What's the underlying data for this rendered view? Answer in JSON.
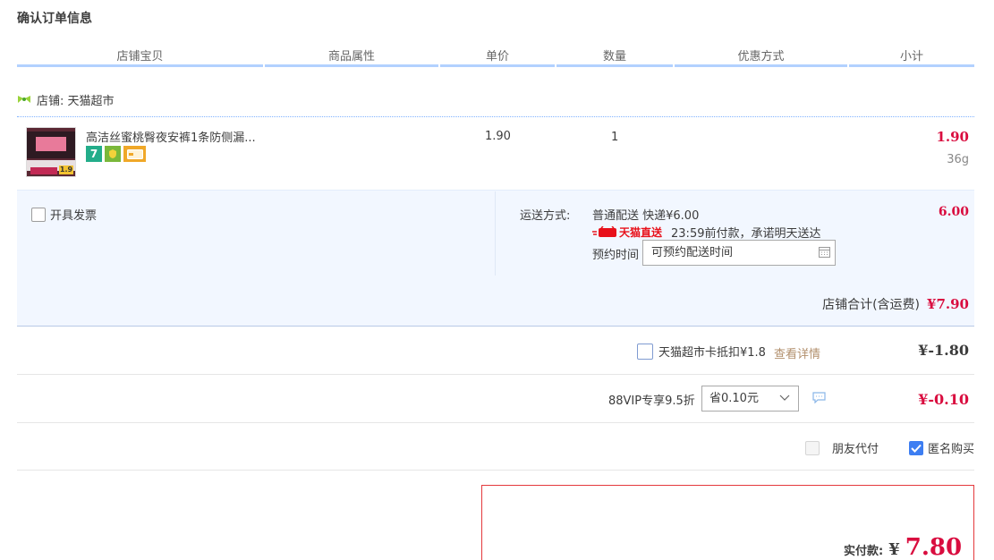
{
  "page_title": "确认订单信息",
  "columns": [
    "店铺宝贝",
    "商品属性",
    "单价",
    "数量",
    "优惠方式",
    "小计"
  ],
  "shop": {
    "label": "店铺: 天猫超市"
  },
  "item": {
    "title": "高洁丝蜜桃臀夜安裤1条防侧漏...",
    "thumb_price": "1.9",
    "unit_price": "1.90",
    "quantity": "1",
    "subtotal": "1.90",
    "weight": "36g",
    "badges": [
      {
        "icon": "seven-day-return-icon",
        "text": "7",
        "color": "#23ad8a"
      },
      {
        "icon": "guarantee-icon",
        "text": "",
        "color": "#7ab83a"
      },
      {
        "icon": "card-payment-icon",
        "text": "",
        "color": "#f0a828"
      }
    ]
  },
  "invoice": {
    "label": "开具发票"
  },
  "shipping": {
    "label": "运送方式:",
    "method": "普通配送 快递¥6.00",
    "tmall_tag": "天猫直送",
    "promise": "23:59前付款，承诺明天送达",
    "reserve_label": "预约时间",
    "reserve_placeholder": "可预约配送时间",
    "fee": "6.00"
  },
  "shop_total": {
    "label": "店铺合计(含运费)",
    "value": "¥7.90"
  },
  "card_deduct": {
    "label": "天猫超市卡抵扣¥1.8",
    "link": "查看详情",
    "value": "¥-1.80"
  },
  "vip": {
    "label": "88VIP专享9.5折",
    "selected": "省0.10元",
    "value": "¥-0.10"
  },
  "options": {
    "friend_pay": "朋友代付",
    "anonymous": "匿名购买"
  },
  "final": {
    "label": "实付款:",
    "currency": "¥",
    "value": "7.80"
  },
  "colors": {
    "accent_red": "#d90d3f",
    "header_line": "#b2d1ff",
    "panel_bg": "#f2f7ff",
    "check_blue": "#3d7ef2"
  }
}
